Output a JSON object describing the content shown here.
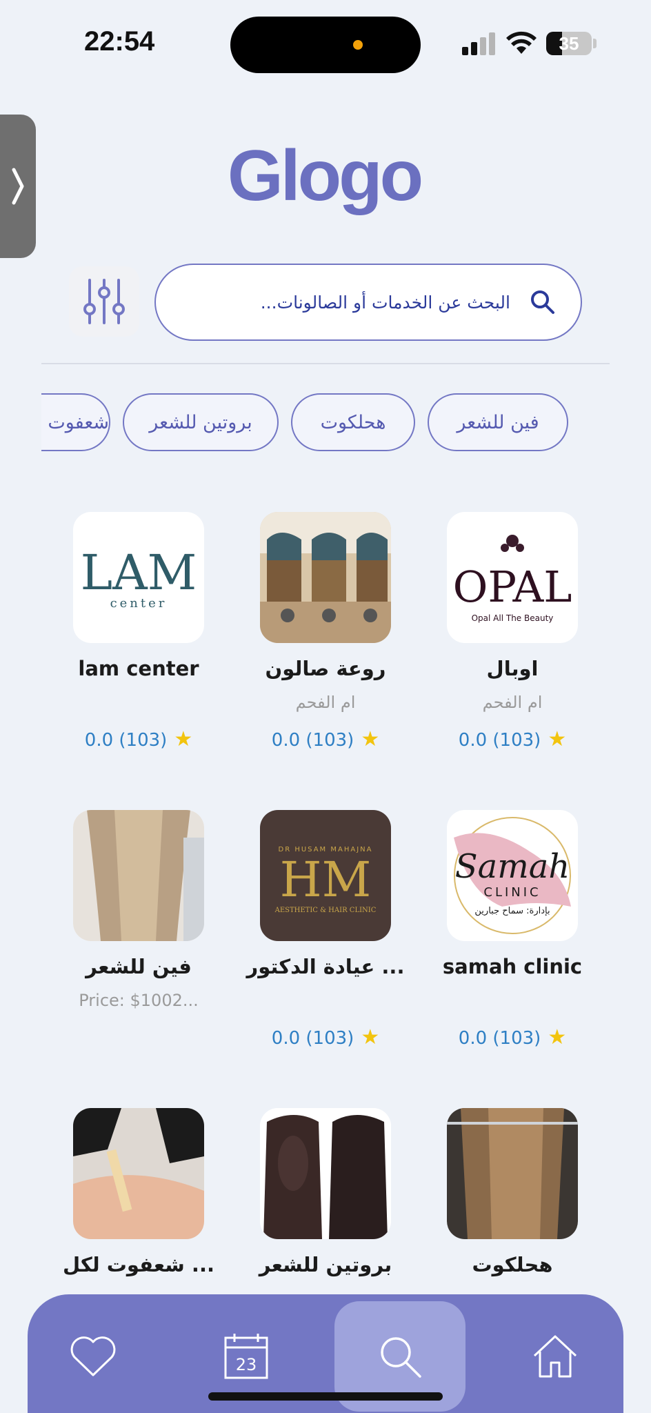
{
  "status_bar": {
    "time": "22:54",
    "battery": "35",
    "battery_level": 0.35
  },
  "header": {
    "logo_text": "Glogo"
  },
  "search": {
    "placeholder": "البحث عن الخدمات أو الصالونات..."
  },
  "chips": [
    "فين للشعر",
    "هحلكوت",
    "بروتين للشعر",
    "شعفوت لكل ..."
  ],
  "cards": [
    {
      "title": "اوبال",
      "subtitle": "ام الفحم",
      "rating": "0.0 (103)",
      "logo": "OPAL",
      "logo_sub": "Opal All The Beauty"
    },
    {
      "title": "روعة صالون",
      "subtitle": "ام الفحم",
      "rating": "0.0 (103)"
    },
    {
      "title": "lam center",
      "subtitle": "",
      "rating": "0.0 (103)",
      "logo": "LAM",
      "logo_sub": "center"
    },
    {
      "title": "samah clinic",
      "subtitle": "",
      "rating": "0.0 (103)",
      "logo": "Samah",
      "logo_sub": "CLINIC",
      "logo_sub2": "بإدارة: سماح جبارين"
    },
    {
      "title": "عيادة الدكتور ...",
      "subtitle": "",
      "rating": "0.0 (103)",
      "logo": "HM",
      "logo_top": "DR HUSAM MAHAJNA",
      "logo_sub": "AESTHETIC & HAIR CLINIC"
    },
    {
      "title": "فين للشعر",
      "subtitle": "Price: $1002...",
      "rating": ""
    },
    {
      "title": "هحلكوت",
      "subtitle": "",
      "rating": ""
    },
    {
      "title": "بروتين للشعر",
      "subtitle": "",
      "rating": ""
    },
    {
      "title": "شعفوت لكل ...",
      "subtitle": "",
      "rating": ""
    }
  ],
  "tabbar": {
    "calendar_day": "23"
  },
  "colors": {
    "accent": "#7377c4",
    "rating": "#2e7fc4",
    "star": "#f2c40f"
  }
}
